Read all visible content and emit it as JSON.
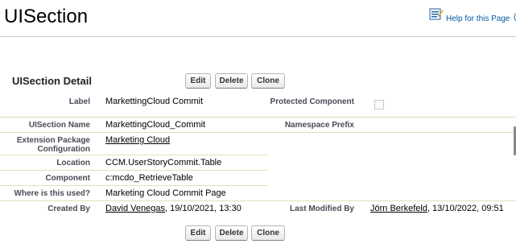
{
  "page": {
    "title": "UISection"
  },
  "help": {
    "label": "Help for this Page",
    "edge_glyph": "("
  },
  "detail": {
    "title": "UISection Detail",
    "buttons": {
      "edit": "Edit",
      "delete": "Delete",
      "clone": "Clone"
    },
    "fields": {
      "label": {
        "label": "Label",
        "value": "MarkettingCloud Commit"
      },
      "protected": {
        "label": "Protected Component",
        "checked": false
      },
      "uisection_name": {
        "label": "UISection Name",
        "value": "MarkettingCloud_Commit"
      },
      "namespace_prefix": {
        "label": "Namespace Prefix",
        "value": ""
      },
      "extension_package": {
        "label": "Extension Package Configuration",
        "value": "Marketing Cloud"
      },
      "location": {
        "label": "Location",
        "value": "CCM.UserStoryCommit.Table"
      },
      "component": {
        "label": "Component",
        "value": "c:mcdo_RetrieveTable"
      },
      "where_used": {
        "label": "Where is this used?",
        "value": "Marketing Cloud Commit Page"
      },
      "created_by": {
        "label": "Created By",
        "user": "David Venegas",
        "date": ", 19/10/2021, 13:30"
      },
      "last_modified_by": {
        "label": "Last Modified By",
        "user": "Jörn Berkefeld",
        "date": ", 13/10/2022, 09:51"
      }
    }
  },
  "colors": {
    "link": "#015ba7",
    "label": "#4a4a56",
    "rule": "#e3deb8"
  }
}
